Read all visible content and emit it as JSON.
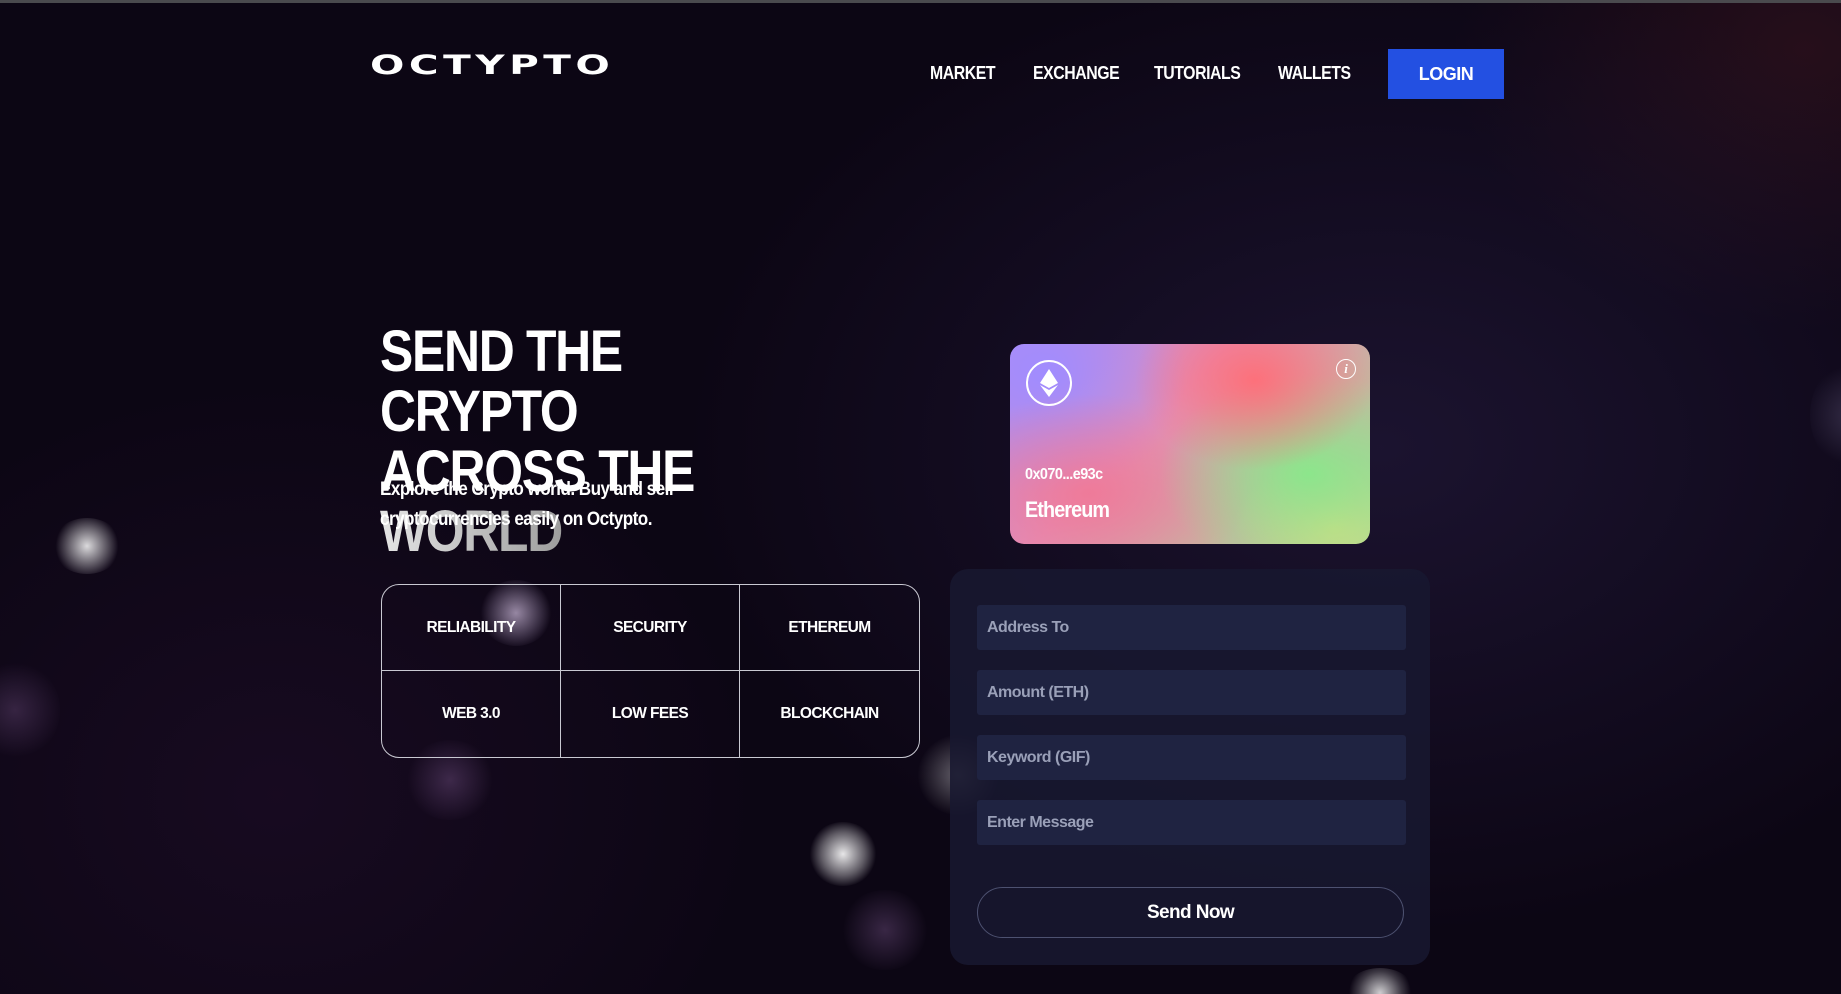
{
  "brand": {
    "logo": "OCTYPTO"
  },
  "nav": {
    "items": [
      {
        "label": "MARKET"
      },
      {
        "label": "EXCHANGE"
      },
      {
        "label": "TUTORIALS"
      },
      {
        "label": "WALLETS"
      }
    ],
    "login_label": "LOGIN",
    "login_color": "#2350e2"
  },
  "hero": {
    "title_line1": "SEND THE CRYPTO",
    "title_line2_part1": "ACROSS THE ",
    "title_line2_part2": "WORLD",
    "subtitle": "Explore the Crypto world. Buy and sell cryptocurrencies easily on Octypto."
  },
  "features": [
    "RELIABILITY",
    "SECURITY",
    "ETHEREUM",
    "WEB 3.0",
    "LOW FEES",
    "BLOCKCHAIN"
  ],
  "card": {
    "icon": "ethereum-icon",
    "info_icon": "info-icon",
    "address": "0x070...e93c",
    "network": "Ethereum"
  },
  "form": {
    "address_placeholder": "Address To",
    "amount_placeholder": "Amount (ETH)",
    "keyword_placeholder": "Keyword (GIF)",
    "message_placeholder": "Enter Message",
    "submit_label": "Send Now"
  }
}
